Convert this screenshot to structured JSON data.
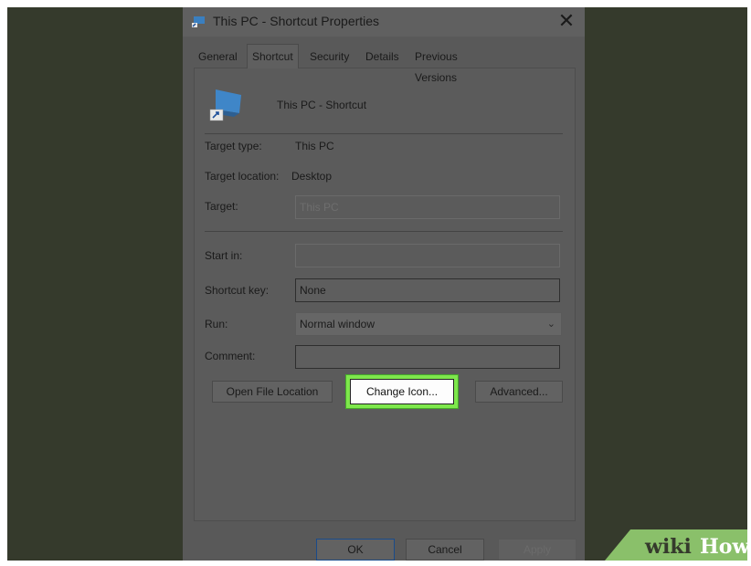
{
  "window": {
    "title": "This PC - Shortcut Properties",
    "close_glyph": "✕"
  },
  "tabs": [
    {
      "label": "General",
      "active": false
    },
    {
      "label": "Shortcut",
      "active": true
    },
    {
      "label": "Security",
      "active": false
    },
    {
      "label": "Details",
      "active": false
    },
    {
      "label": "Previous Versions",
      "active": false
    }
  ],
  "shortcut": {
    "name": "This PC - Shortcut",
    "icon": "computer-icon"
  },
  "fields": {
    "target_type_label": "Target type:",
    "target_type_value": "This PC",
    "target_location_label": "Target location:",
    "target_location_value": "Desktop",
    "target_label": "Target:",
    "target_value": "This PC",
    "start_in_label": "Start in:",
    "start_in_value": "",
    "shortcut_key_label": "Shortcut key:",
    "shortcut_key_value": "None",
    "run_label": "Run:",
    "run_value": "Normal window",
    "comment_label": "Comment:",
    "comment_value": ""
  },
  "buttons": {
    "open_file_location": "Open File Location",
    "change_icon": "Change Icon...",
    "advanced": "Advanced...",
    "ok": "OK",
    "cancel": "Cancel",
    "apply": "Apply"
  },
  "highlight_color": "#7ee84c",
  "watermark": {
    "wiki": "wiki",
    "how": "How"
  }
}
